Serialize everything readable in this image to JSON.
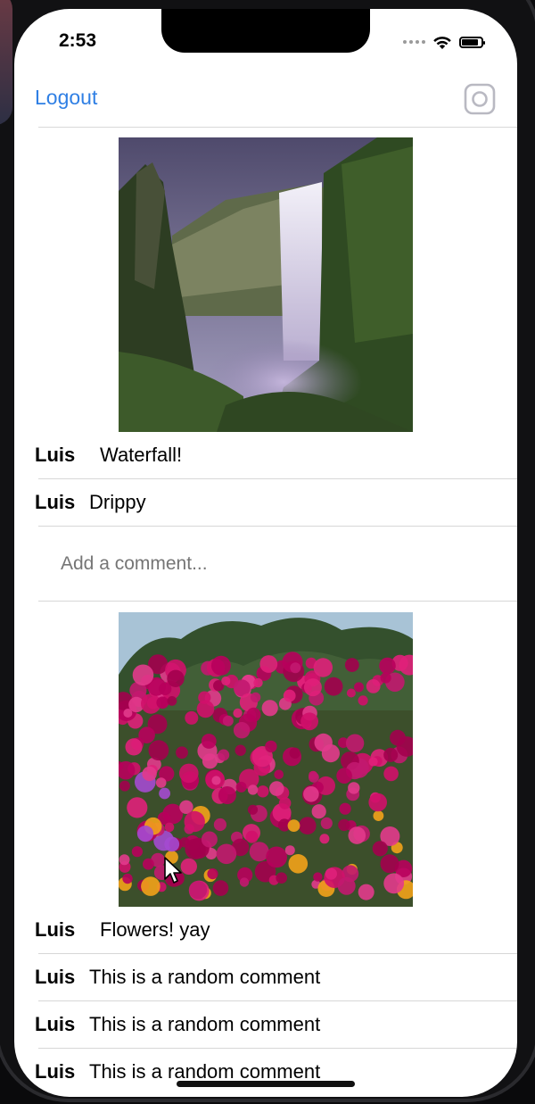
{
  "status_bar": {
    "time": "2:53",
    "battery_level": 0.85
  },
  "navbar": {
    "logout_label": "Logout",
    "camera_icon": "instagram-camera-icon"
  },
  "posts": [
    {
      "image_icon": "waterfall-photo",
      "caption_user": "Luis",
      "caption": "Waterfall!",
      "comments": [
        {
          "user": "Luis",
          "text": "Drippy"
        }
      ],
      "comment_placeholder": "Add a comment..."
    },
    {
      "image_icon": "flowers-photo",
      "caption_user": "Luis",
      "caption": "Flowers! yay",
      "comments": [
        {
          "user": "Luis",
          "text": "This is a random comment"
        },
        {
          "user": "Luis",
          "text": "This is a random comment"
        },
        {
          "user": "Luis",
          "text": "This is a random comment"
        }
      ]
    }
  ],
  "colors": {
    "accent": "#2f7fe4",
    "divider": "#d7d7d7",
    "placeholder": "#c8d4e6"
  }
}
